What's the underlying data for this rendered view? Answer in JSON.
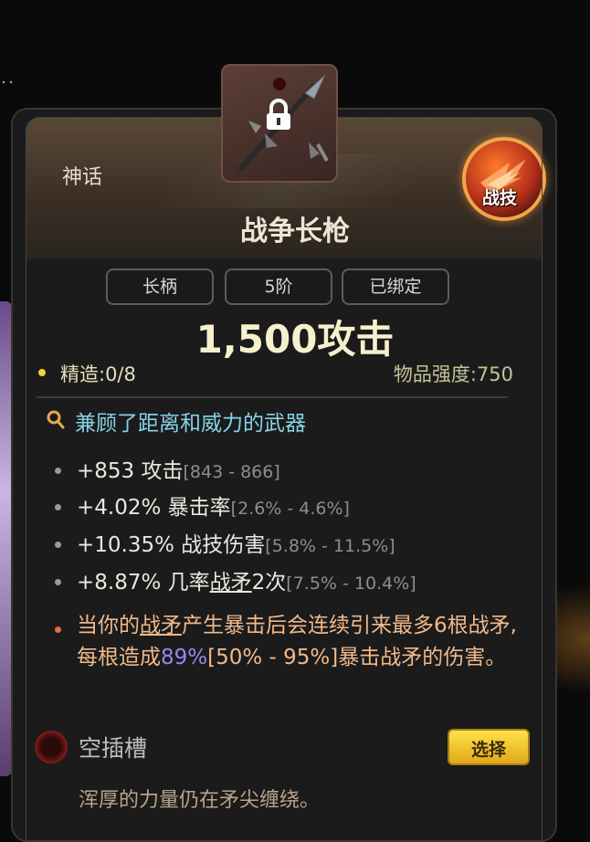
{
  "rarity": "神话",
  "skill_badge": {
    "label": "战技",
    "icon": "flame-burst-icon"
  },
  "item": {
    "icon": "spear-icon",
    "lock_icon": "lock-icon",
    "name": "战争长枪"
  },
  "tags": [
    "长柄",
    "5阶",
    "已绑定"
  ],
  "attack": "1,500攻击",
  "refine": "精造:0/8",
  "item_power": "物品强度:750",
  "description": {
    "icon": "magnifier-icon",
    "text": "兼顾了距离和威力的武器"
  },
  "stats": [
    {
      "value": "+853 攻击",
      "range": "[843 - 866]"
    },
    {
      "value": "+4.02% 暴击率",
      "range": "[2.6% - 4.6%]"
    },
    {
      "value": "+10.35% 战技伤害",
      "range": "[5.8% - 11.5%]"
    },
    {
      "value_pre": "+8.87% 几率",
      "value_ul": "战矛",
      "value_post": "2次",
      "range": "[7.5% - 10.4%]"
    }
  ],
  "effect": {
    "p1": "当你的",
    "ul": "战矛",
    "p2": "产生暴击后会连续引来最多6根战矛,每根造成",
    "highlight": "89%",
    "p3": "[50% - 95%]暴击战矛的伤害。"
  },
  "socket": {
    "label": "空插槽",
    "button": "选择"
  },
  "flavor": "浑厚的力量仍在矛尖缠绕。",
  "colors": {
    "rarity_text": "#e6dccd",
    "desc_text": "#86d3e6",
    "effect_text": "#f0b98a",
    "highlight": "#9a86f0",
    "button": "#ffd93a"
  }
}
